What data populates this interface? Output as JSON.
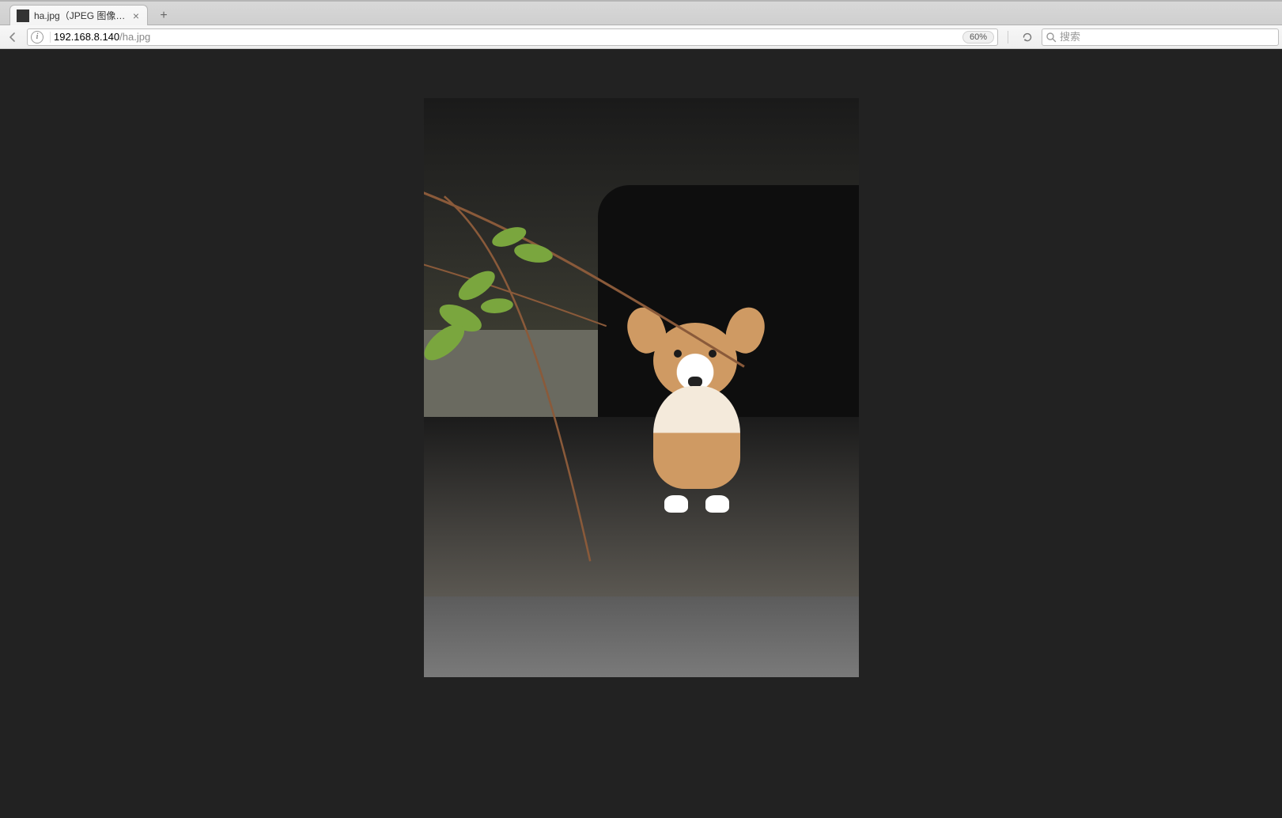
{
  "tab": {
    "title": "ha.jpg（JPEG 图像，...",
    "close_symbol": "×"
  },
  "url": {
    "host": "192.168.8.140",
    "path": "/ha.jpg"
  },
  "toolbar": {
    "zoom_level": "60%",
    "new_tab_symbol": "+",
    "info_symbol": "i"
  },
  "search": {
    "placeholder": "搜索"
  },
  "image": {
    "alt": "ha.jpg"
  }
}
